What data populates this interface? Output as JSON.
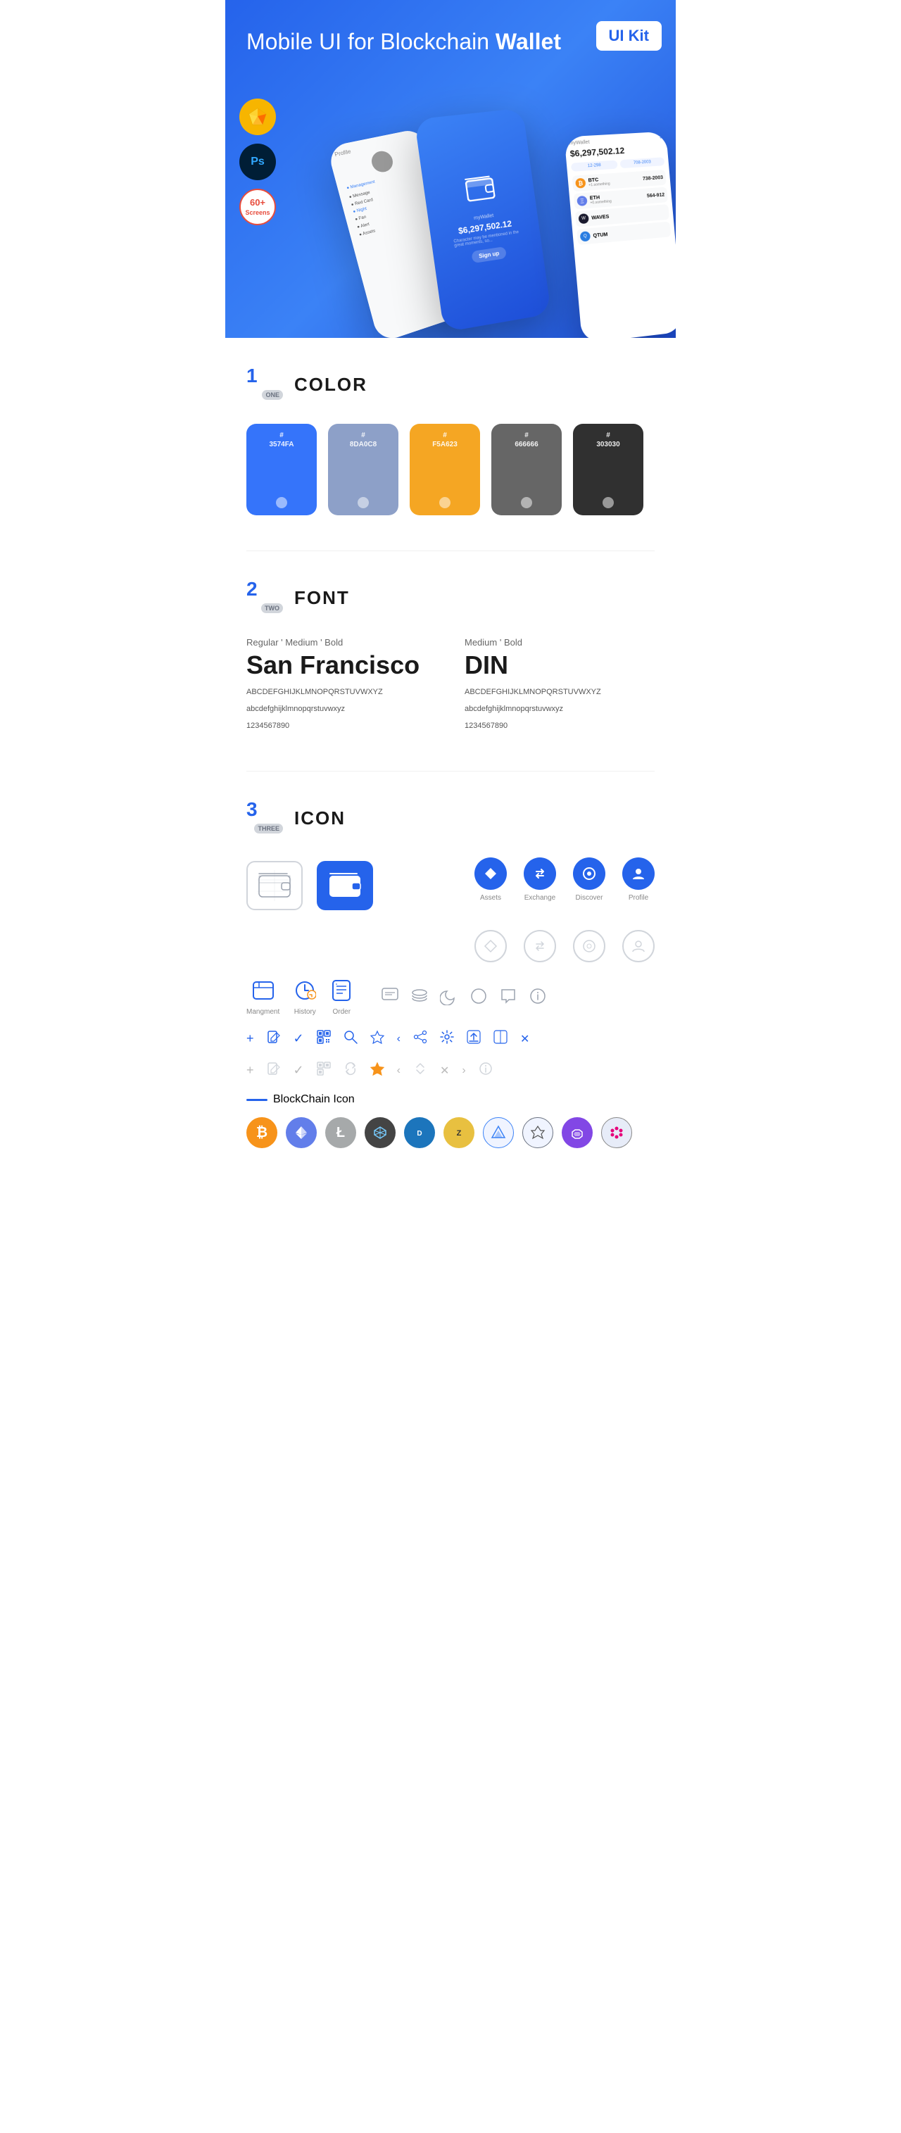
{
  "hero": {
    "title": "Mobile UI for Blockchain ",
    "title_bold": "Wallet",
    "badge": "UI Kit",
    "badges": [
      {
        "label": "Sketch",
        "type": "sketch"
      },
      {
        "label": "Ps",
        "type": "ps"
      },
      {
        "label": "60+\nScreens",
        "type": "screens"
      }
    ],
    "phone_center_amount": "$6,297,502.12",
    "phone_label": "myWallet"
  },
  "sections": {
    "color": {
      "number": "1",
      "word": "ONE",
      "title": "COLOR",
      "swatches": [
        {
          "hex": "#3574FA",
          "label": "#\n3574FA",
          "bg": "#3574FA"
        },
        {
          "hex": "#8DA0C8",
          "label": "#\n8DA0C8",
          "bg": "#8DA0C8"
        },
        {
          "hex": "#F5A623",
          "label": "#\nF5A623",
          "bg": "#F5A623"
        },
        {
          "hex": "#666666",
          "label": "#\n666666",
          "bg": "#666666"
        },
        {
          "hex": "#303030",
          "label": "#\n303030",
          "bg": "#303030"
        }
      ]
    },
    "font": {
      "number": "2",
      "word": "TWO",
      "title": "FONT",
      "fonts": [
        {
          "style_label": "Regular ' Medium ' Bold",
          "name": "San Francisco",
          "uppercase": "ABCDEFGHIJKLMNOPQRSTUVWXYZ",
          "lowercase": "abcdefghijklmnopqrstuvwxyz",
          "numbers": "1234567890"
        },
        {
          "style_label": "Medium ' Bold",
          "name": "DIN",
          "uppercase": "ABCDEFGHIJKLMNOPQRSTUVWXYZ",
          "lowercase": "abcdefghijklmnopqrstuvwxyz",
          "numbers": "1234567890"
        }
      ]
    },
    "icon": {
      "number": "3",
      "word": "THREE",
      "title": "ICON",
      "wallet_icons": [
        {
          "type": "outline",
          "label": ""
        },
        {
          "type": "filled",
          "label": ""
        }
      ],
      "circle_icons": [
        {
          "label": "Assets",
          "type": "diamond"
        },
        {
          "label": "Exchange",
          "type": "exchange"
        },
        {
          "label": "Discover",
          "type": "discover"
        },
        {
          "label": "Profile",
          "type": "profile"
        }
      ],
      "bottom_icons": [
        {
          "label": "Mangment",
          "type": "management"
        },
        {
          "label": "History",
          "type": "history"
        },
        {
          "label": "Order",
          "type": "order"
        }
      ],
      "misc_icons": [
        "chat",
        "layers",
        "moon",
        "circle",
        "speech",
        "info"
      ],
      "action_icons_row1": [
        "+",
        "document",
        "check",
        "qr",
        "search",
        "star",
        "back",
        "share",
        "settings",
        "upload",
        "split",
        "close"
      ],
      "action_icons_row2": [
        "+",
        "document",
        "check",
        "qr",
        "refresh",
        "star",
        "back",
        "arrows",
        "x",
        "forward",
        "info"
      ],
      "blockchain_label": "BlockChain Icon",
      "crypto_icons": [
        {
          "symbol": "₿",
          "name": "Bitcoin",
          "class": "crypto-btc"
        },
        {
          "symbol": "Ξ",
          "name": "Ethereum",
          "class": "crypto-eth"
        },
        {
          "symbol": "Ł",
          "name": "Litecoin",
          "class": "crypto-ltc"
        },
        {
          "symbol": "◆",
          "name": "NEM",
          "class": "crypto-nem"
        },
        {
          "symbol": "D",
          "name": "Dash",
          "class": "crypto-dash"
        },
        {
          "symbol": "Z",
          "name": "Zcash",
          "class": "crypto-zcash"
        },
        {
          "symbol": "◎",
          "name": "IOTA",
          "class": "crypto-iota"
        },
        {
          "symbol": "▲",
          "name": "ARK",
          "class": "crypto-ark"
        },
        {
          "symbol": "⬡",
          "name": "Polygon",
          "class": "crypto-matic"
        },
        {
          "symbol": "∞",
          "name": "Polkadot",
          "class": "crypto-poly"
        }
      ]
    }
  }
}
